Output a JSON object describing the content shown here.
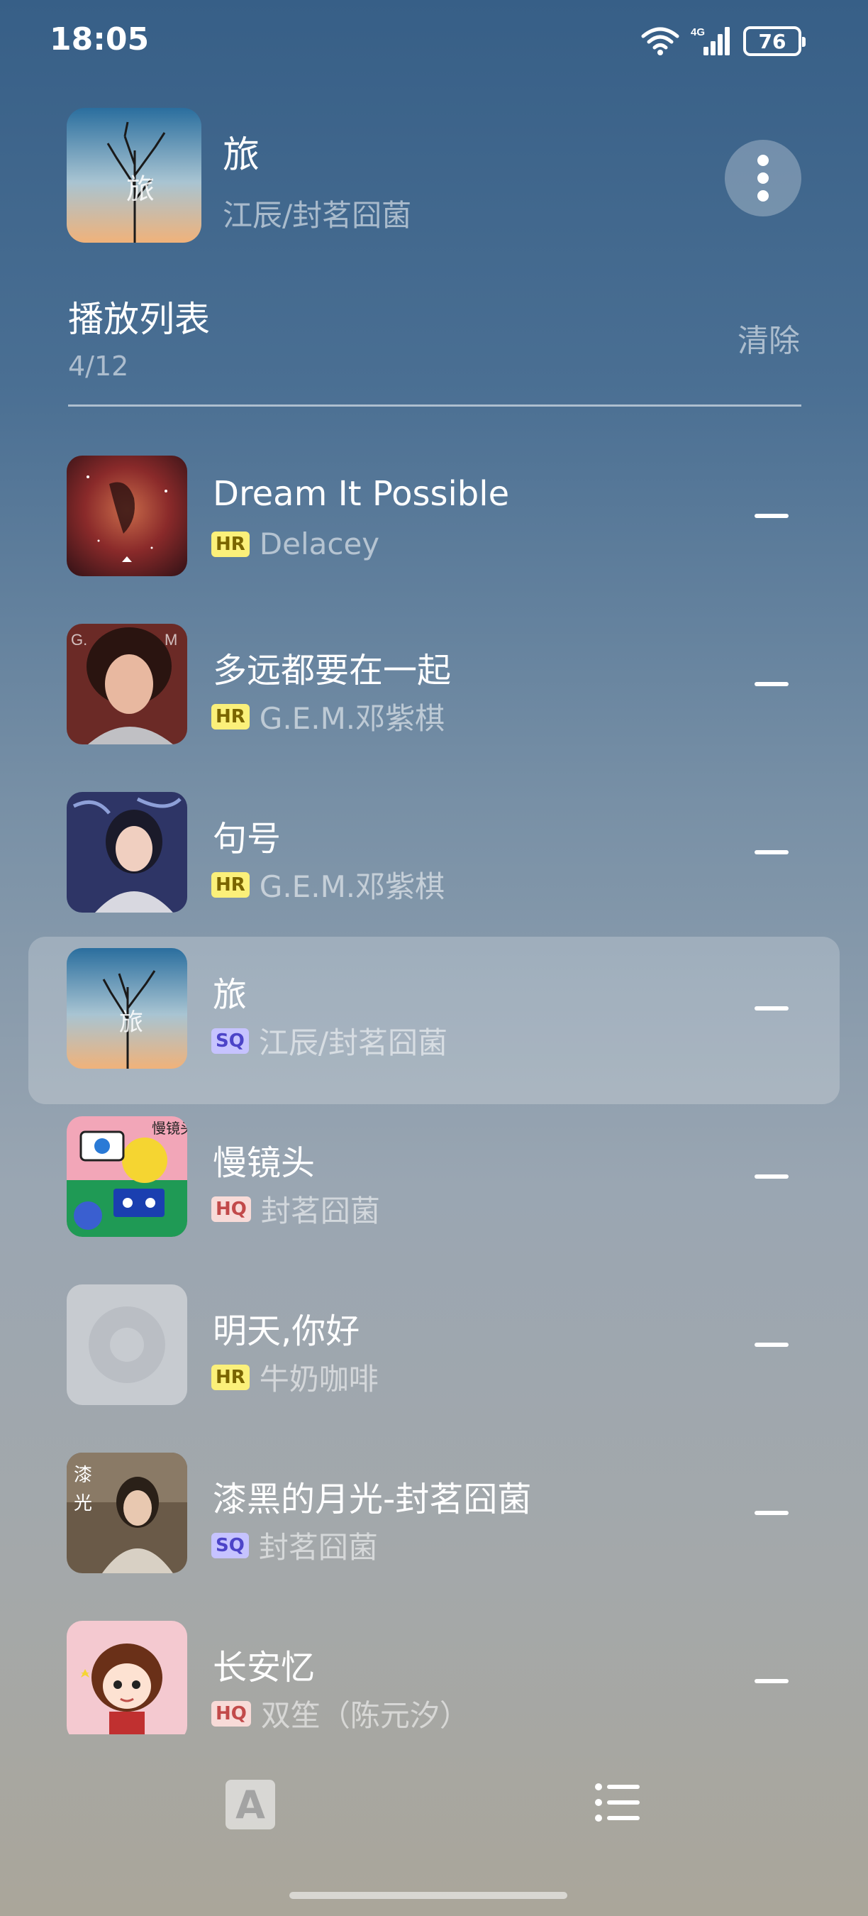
{
  "status_bar": {
    "time": "18:05",
    "network": "4G",
    "battery": "76"
  },
  "now_playing": {
    "title": "旅",
    "artist": "江辰/封茗囧菌",
    "more_icon": "more-vertical-icon"
  },
  "playlist": {
    "title": "播放列表",
    "count": "4/12",
    "clear_label": "清除",
    "tracks": [
      {
        "title": "Dream It Possible",
        "quality": "HR",
        "artist": "Delacey",
        "cover": "nebula-cover",
        "active": false
      },
      {
        "title": "多远都要在一起",
        "quality": "HR",
        "artist": "G.E.M.邓紫棋",
        "cover": "portrait-red-cover",
        "active": false
      },
      {
        "title": "句号",
        "quality": "HR",
        "artist": "G.E.M.邓紫棋",
        "cover": "portrait-blue-cover",
        "active": false
      },
      {
        "title": "旅",
        "quality": "SQ",
        "artist": "江辰/封茗囧菌",
        "cover": "tree-sky-cover",
        "active": true
      },
      {
        "title": "慢镜头",
        "quality": "HQ",
        "artist": "封茗囧菌",
        "cover": "colorful-camera-cover",
        "active": false
      },
      {
        "title": "明天,你好",
        "quality": "HR",
        "artist": "牛奶咖啡",
        "cover": "placeholder-disc-cover",
        "active": false
      },
      {
        "title": "漆黑的月光-封茗囧菌",
        "quality": "SQ",
        "artist": "封茗囧菌",
        "cover": "girl-sepia-cover",
        "active": false
      },
      {
        "title": "长安忆",
        "quality": "HQ",
        "artist": "双笙（陈元汐）",
        "cover": "cartoon-girl-cover",
        "active": false
      }
    ]
  },
  "bottom_bar": {
    "lyrics_label": "A",
    "list_icon": "playlist-icon"
  }
}
